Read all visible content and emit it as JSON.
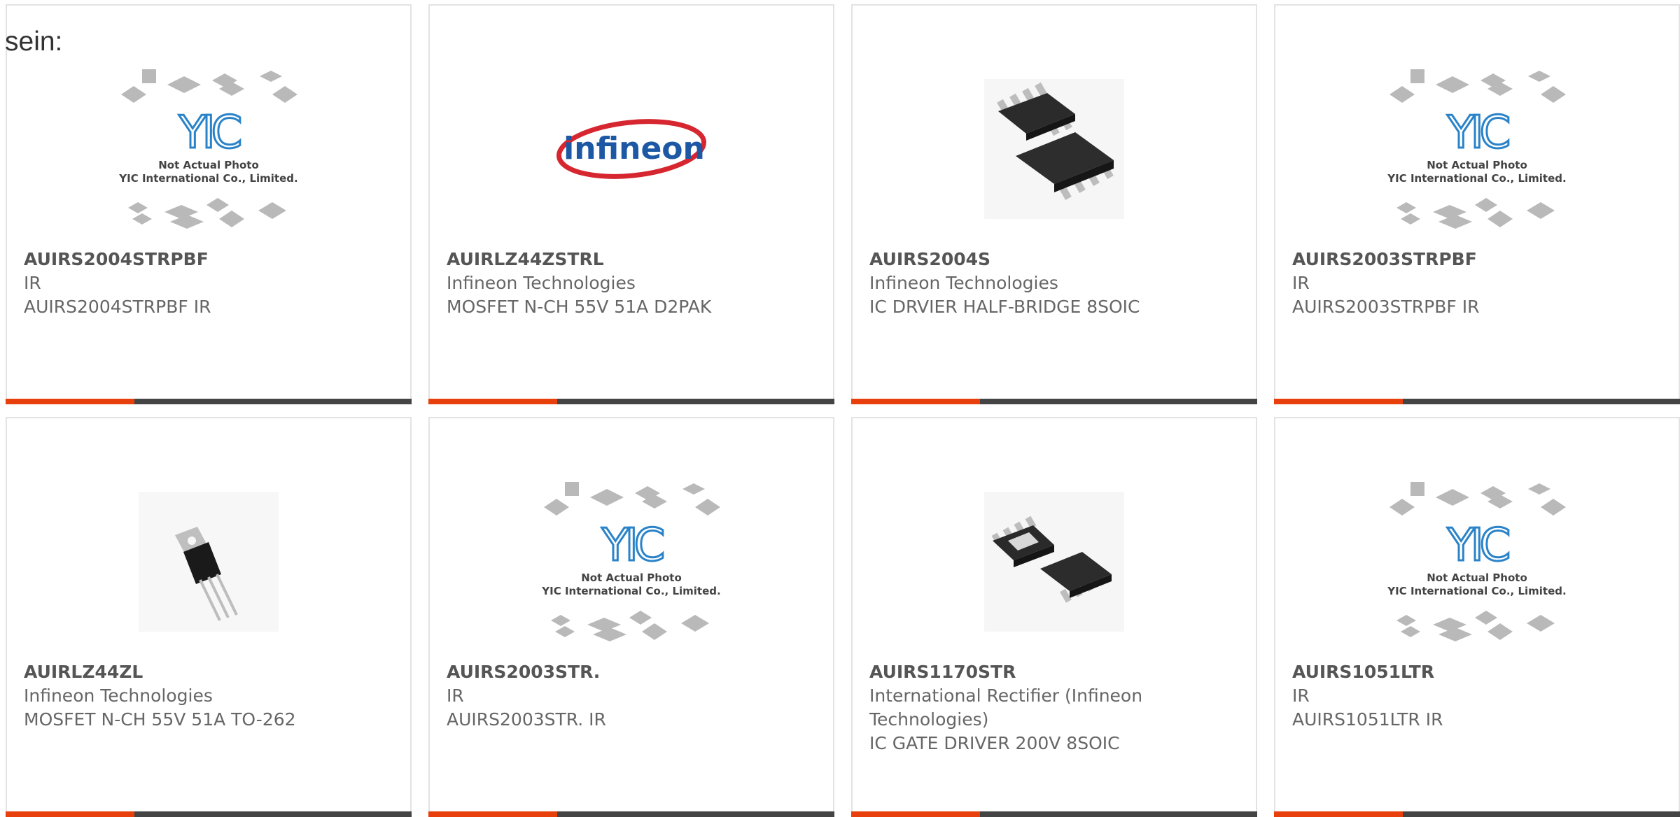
{
  "intro_text": "sein:",
  "placeholder": {
    "line1": "Not Actual Photo",
    "line2": "YIC International Co., Limited.",
    "logo": "YIC"
  },
  "infineon_logo": "infineon",
  "accent_color": "#e8400c",
  "products": [
    {
      "part": "AUIRS2004STRPBF",
      "manufacturer": "IR",
      "description": "AUIRS2004STRPBF IR",
      "image": "yic-placeholder"
    },
    {
      "part": "AUIRLZ44ZSTRL",
      "manufacturer": "Infineon Technologies",
      "description": "MOSFET N-CH 55V 51A D2PAK",
      "image": "infineon-logo"
    },
    {
      "part": "AUIRS2004S",
      "manufacturer": "Infineon Technologies",
      "description": "IC DRVIER HALF-BRIDGE 8SOIC",
      "image": "soic8-chips"
    },
    {
      "part": "AUIRS2003STRPBF",
      "manufacturer": "IR",
      "description": "AUIRS2003STRPBF IR",
      "image": "yic-placeholder"
    },
    {
      "part": "AUIRLZ44ZL",
      "manufacturer": "Infineon Technologies",
      "description": "MOSFET N-CH 55V 51A TO-262",
      "image": "to262-transistor"
    },
    {
      "part": "AUIRS2003STR.",
      "manufacturer": "IR",
      "description": "AUIRS2003STR. IR",
      "image": "yic-placeholder"
    },
    {
      "part": "AUIRS1170STR",
      "manufacturer": "International Rectifier (Infineon Technologies)",
      "description": "IC GATE DRIVER 200V 8SOIC",
      "image": "soic8-chips"
    },
    {
      "part": "AUIRS1051LTR",
      "manufacturer": "IR",
      "description": "AUIRS1051LTR IR",
      "image": "yic-placeholder"
    }
  ]
}
